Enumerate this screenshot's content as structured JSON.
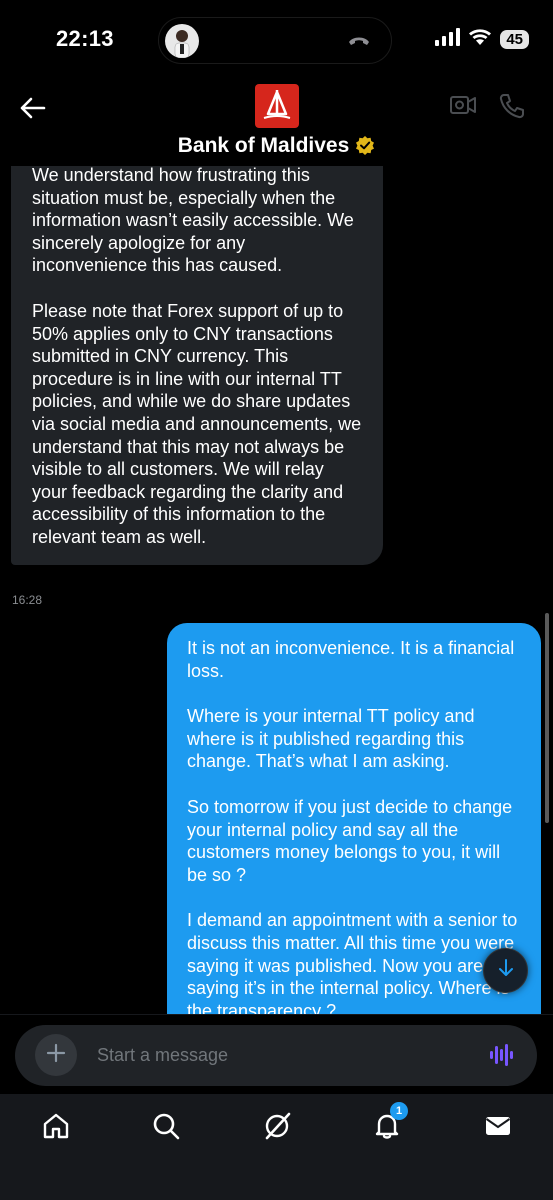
{
  "status_bar": {
    "time": "22:13",
    "battery": "45",
    "icons": [
      "signal-icon",
      "wifi-icon",
      "battery-icon"
    ]
  },
  "header": {
    "title": "Bank of Maldives",
    "logo_color": "#d6261c",
    "verified_color": "#e2b719"
  },
  "conversation": {
    "incoming": {
      "paragraphs": [
        "We understand how frustrating this situation must be, especially when the information wasn’t easily accessible. We sincerely apologize for any inconvenience this has caused.",
        "Please note that Forex support of up to 50% applies only to CNY transactions submitted in CNY currency. This procedure is in line with our internal TT policies, and while we do share updates via social media and announcements, we understand that this may not always be visible to all customers. We will relay your feedback regarding the clarity and accessibility of this information to the relevant team as well."
      ],
      "timestamp": "16:28"
    },
    "outgoing": {
      "paragraphs": [
        "It is not an inconvenience.  It is a financial loss.",
        "Where is your internal TT policy and where is it published regarding this change. That’s what I am asking.",
        "So tomorrow if you just decide to change your internal policy and say all the customers money belongs to you, it will be so ?",
        "I demand an appointment with a senior to discuss this matter. All this time you were saying it was published. Now you are saying it’s in the internal policy. Where is the transparency ?"
      ]
    }
  },
  "composer": {
    "placeholder": "Start a message",
    "voice_color": "#7856ff"
  },
  "tabbar": {
    "items": [
      "home-icon",
      "search-icon",
      "grok-icon",
      "notifications-icon",
      "messages-icon"
    ],
    "notification_badge": "1"
  },
  "colors": {
    "accent": "#1d9bf0",
    "incoming_bubble": "#202327"
  }
}
